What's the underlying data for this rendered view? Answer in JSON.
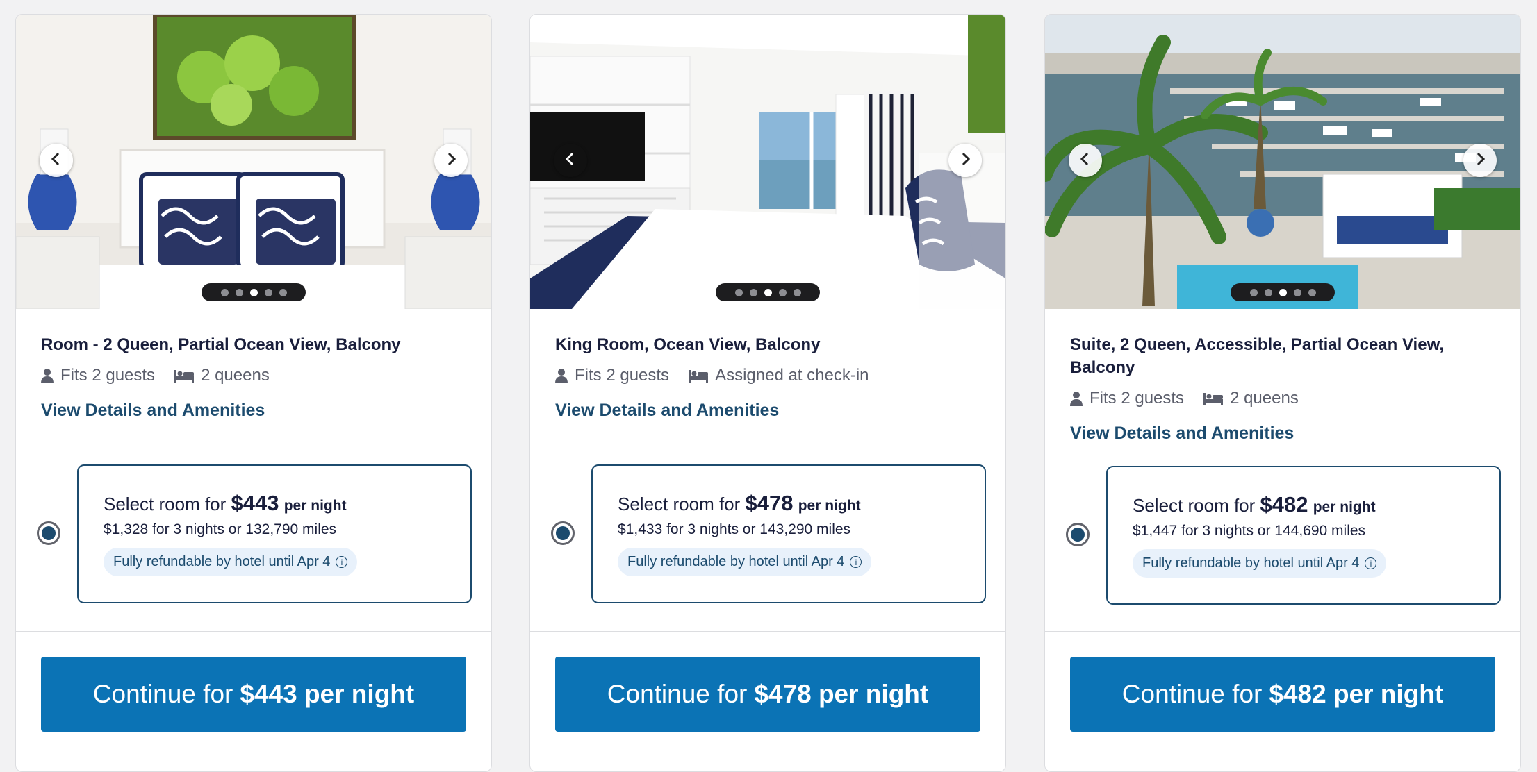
{
  "rooms": [
    {
      "title": "Room - 2 Queen, Partial Ocean View, Balcony",
      "guests": "Fits 2 guests",
      "beds": "2 queens",
      "details_link": "View Details and Amenities",
      "select_prefix": "Select room for",
      "price": "$443",
      "per_night": "per night",
      "total": "$1,328 for 3 nights or 132,790 miles",
      "refund": "Fully refundable by hotel until Apr 4",
      "cta_prefix": "Continue for",
      "cta_price": "$443 per night",
      "photo_subject": "bedroom-with-coconut-painting"
    },
    {
      "title": "King Room, Ocean View, Balcony",
      "guests": "Fits 2 guests",
      "beds": "Assigned at check-in",
      "details_link": "View Details and Amenities",
      "select_prefix": "Select room for",
      "price": "$478",
      "per_night": "per night",
      "total": "$1,433 for 3 nights or 143,290 miles",
      "refund": "Fully refundable by hotel until Apr 4",
      "cta_prefix": "Continue for",
      "cta_price": "$478 per night",
      "photo_subject": "king-bedroom-with-tv-and-balcony"
    },
    {
      "title": "Suite, 2 Queen, Accessible, Partial Ocean View, Balcony",
      "guests": "Fits 2 guests",
      "beds": "2 queens",
      "details_link": "View Details and Amenities",
      "select_prefix": "Select room for",
      "price": "$482",
      "per_night": "per night",
      "total": "$1,447 for 3 nights or 144,690 miles",
      "refund": "Fully refundable by hotel until Apr 4",
      "cta_prefix": "Continue for",
      "cta_price": "$482 per night",
      "photo_subject": "marina-and-pool-view"
    }
  ],
  "carousel": {
    "dot_count": 5,
    "active_dot": 3
  },
  "colors": {
    "accent": "#0b73b5",
    "link": "#1c4b6e",
    "pill_bg": "#e8f1fb"
  },
  "icons": [
    "person-icon",
    "bed-icon",
    "info-icon",
    "chevron-left-icon",
    "chevron-right-icon"
  ]
}
